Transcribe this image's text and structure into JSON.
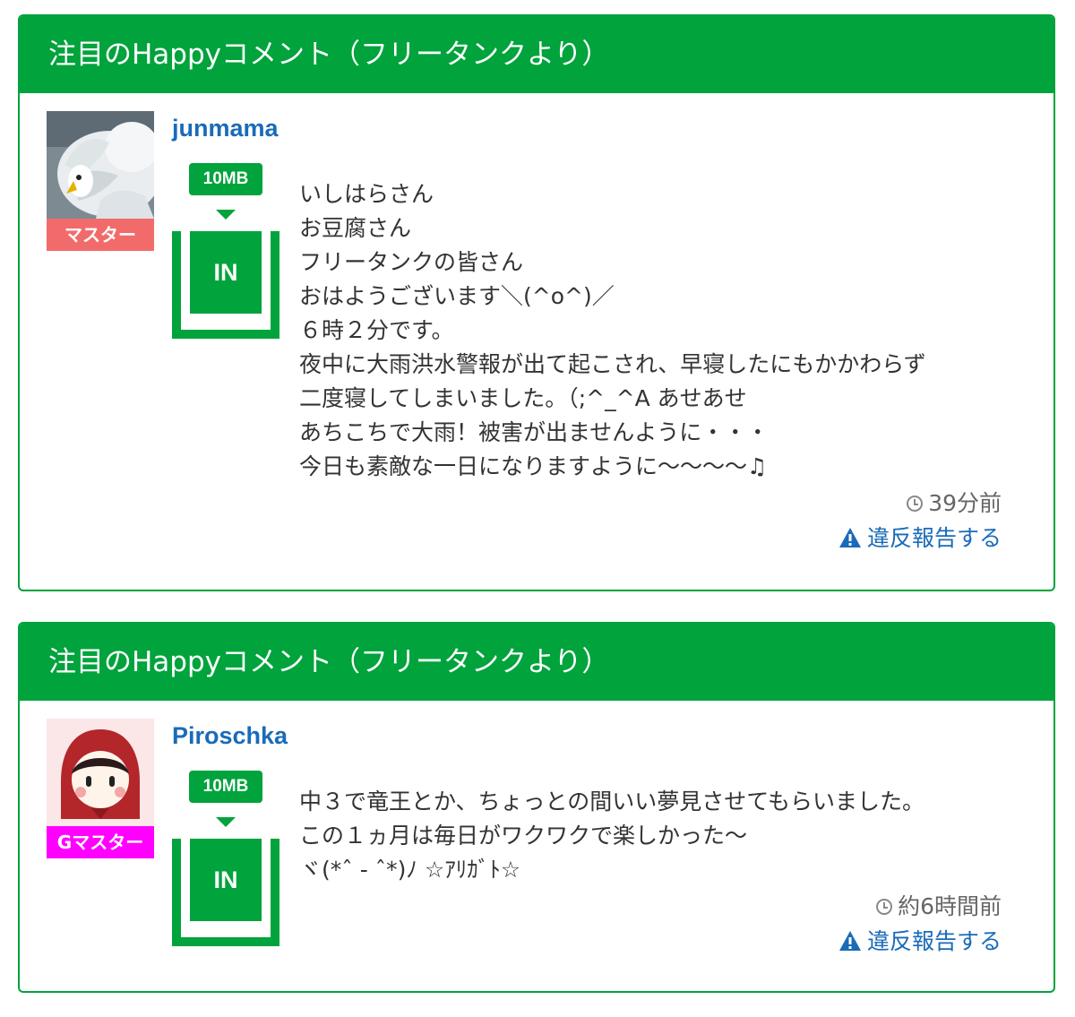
{
  "comments": [
    {
      "header": "注目のHappyコメント（フリータンクより）",
      "username": "junmama",
      "badge": "マスター",
      "badge_color": "#f26b6b",
      "avatar_icon": "swan-photo",
      "rank_size": "10MB",
      "rank_label": "IN",
      "lines": [
        "いしはらさん",
        "お豆腐さん",
        "フリータンクの皆さん",
        "おはようございます＼(^o^)／",
        "６時２分です。",
        "夜中に大雨洪水警報が出て起こされ、早寝したにもかかわらず",
        "二度寝してしまいました。（;^_^A あせあせ",
        "あちこちで大雨！被害が出ませんように・・・",
        "今日も素敵な一日になりますように〜〜〜〜♫"
      ],
      "time": "39分前",
      "report": "違反報告する"
    },
    {
      "header": "注目のHappyコメント（フリータンクより）",
      "username": "Piroschka",
      "badge": "Gマスター",
      "badge_color": "#ff00ff",
      "avatar_icon": "red-hood-girl-icon",
      "rank_size": "10MB",
      "rank_label": "IN",
      "lines": [
        "中３で竜王とか、ちょっとの間いい夢見させてもらいました。",
        "この１ヵ月は毎日がワクワクで楽しかった〜",
        "ヾ(*ˆ - ˆ*)ﾉ ☆ｱﾘｶﾞﾄ☆"
      ],
      "time": "約6時間前",
      "report": "違反報告する"
    }
  ],
  "colors": {
    "header_green": "#00a33c",
    "link_blue": "#1a6bb8",
    "text": "#333333"
  }
}
